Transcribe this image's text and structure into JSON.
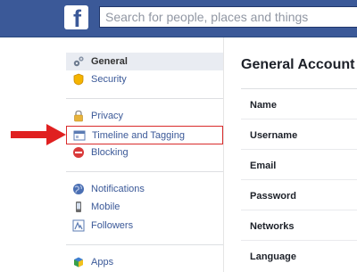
{
  "header": {
    "logo_letter": "f",
    "search_placeholder": "Search for people, places and things",
    "background_color": "#3b5998"
  },
  "sidebar": {
    "items": [
      {
        "label": "General",
        "icon": "gears-icon",
        "active": true
      },
      {
        "label": "Security",
        "icon": "badge-icon"
      },
      {
        "label": "Privacy",
        "icon": "lock-icon"
      },
      {
        "label": "Timeline and Tagging",
        "icon": "timeline-icon",
        "highlighted": true
      },
      {
        "label": "Blocking",
        "icon": "blocking-icon"
      },
      {
        "label": "Notifications",
        "icon": "globe-icon"
      },
      {
        "label": "Mobile",
        "icon": "mobile-icon"
      },
      {
        "label": "Followers",
        "icon": "followers-icon"
      },
      {
        "label": "Apps",
        "icon": "apps-icon"
      }
    ]
  },
  "main": {
    "title": "General Account",
    "rows": [
      "Name",
      "Username",
      "Email",
      "Password",
      "Networks",
      "Language"
    ]
  },
  "annotation": {
    "arrow_color": "#e02020",
    "box_color": "#d92b2b"
  }
}
